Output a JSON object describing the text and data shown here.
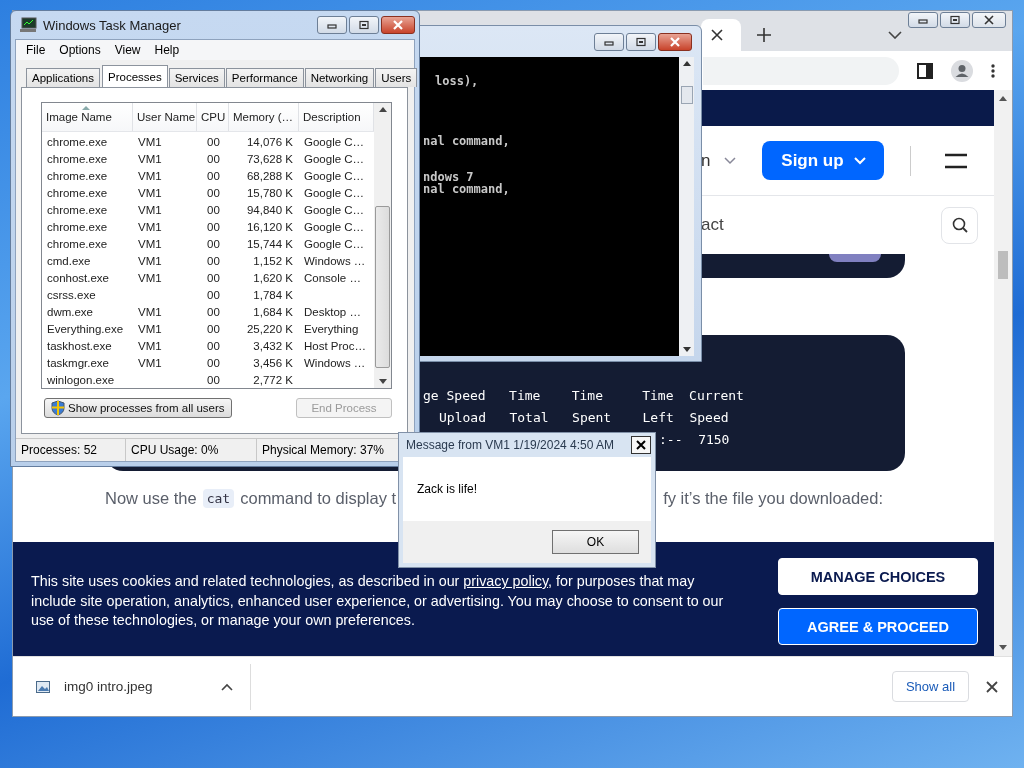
{
  "task_manager": {
    "title": "Windows Task Manager",
    "menu": [
      "File",
      "Options",
      "View",
      "Help"
    ],
    "tabs": [
      {
        "label": "Applications",
        "selected": false
      },
      {
        "label": "Processes",
        "selected": true
      },
      {
        "label": "Services",
        "selected": false
      },
      {
        "label": "Performance",
        "selected": false
      },
      {
        "label": "Networking",
        "selected": false
      },
      {
        "label": "Users",
        "selected": false
      }
    ],
    "columns": [
      {
        "label": "Image Name",
        "sorted": true
      },
      {
        "label": "User Name",
        "sorted": false
      },
      {
        "label": "CPU",
        "sorted": false
      },
      {
        "label": "Memory (…",
        "sorted": false
      },
      {
        "label": "Description",
        "sorted": false
      }
    ],
    "rows": [
      {
        "image": "chrome.exe",
        "user": "VM1",
        "cpu": "00",
        "memory": "14,076 K",
        "description": "Google C…"
      },
      {
        "image": "chrome.exe",
        "user": "VM1",
        "cpu": "00",
        "memory": "73,628 K",
        "description": "Google C…"
      },
      {
        "image": "chrome.exe",
        "user": "VM1",
        "cpu": "00",
        "memory": "68,288 K",
        "description": "Google C…"
      },
      {
        "image": "chrome.exe",
        "user": "VM1",
        "cpu": "00",
        "memory": "15,780 K",
        "description": "Google C…"
      },
      {
        "image": "chrome.exe",
        "user": "VM1",
        "cpu": "00",
        "memory": "94,840 K",
        "description": "Google C…"
      },
      {
        "image": "chrome.exe",
        "user": "VM1",
        "cpu": "00",
        "memory": "16,120 K",
        "description": "Google C…"
      },
      {
        "image": "chrome.exe",
        "user": "VM1",
        "cpu": "00",
        "memory": "15,744 K",
        "description": "Google C…"
      },
      {
        "image": "cmd.exe",
        "user": "VM1",
        "cpu": "00",
        "memory": "1,152 K",
        "description": "Windows …"
      },
      {
        "image": "conhost.exe",
        "user": "VM1",
        "cpu": "00",
        "memory": "1,620 K",
        "description": "Console …"
      },
      {
        "image": "csrss.exe",
        "cpu": "00",
        "memory": "1,784 K"
      },
      {
        "image": "dwm.exe",
        "user": "VM1",
        "cpu": "00",
        "memory": "1,684 K",
        "description": "Desktop …"
      },
      {
        "image": "Everything.exe",
        "user": "VM1",
        "cpu": "00",
        "memory": "25,220 K",
        "description": "Everything"
      },
      {
        "image": "taskhost.exe",
        "user": "VM1",
        "cpu": "00",
        "memory": "3,432 K",
        "description": "Host Proc…"
      },
      {
        "image": "taskmgr.exe",
        "user": "VM1",
        "cpu": "00",
        "memory": "3,456 K",
        "description": "Windows …"
      },
      {
        "image": "winlogon.exe",
        "cpu": "00",
        "memory": "2,772 K"
      }
    ],
    "show_all_button": {
      "label": "Show processes from all users",
      "disabled": false
    },
    "end_process_button": {
      "label": "End Process",
      "disabled": true
    },
    "status_bar": [
      "Processes: 52",
      "CPU Usage: 0%",
      "Physical Memory: 37%"
    ]
  },
  "console": {
    "lines": [
      "loss),",
      "nal command,",
      "ndows 7",
      "nal command,"
    ]
  },
  "browser": {
    "page": {
      "nav_fragment": "n",
      "signup_button": "Sign up",
      "subnav_fragment": "act",
      "terminal": {
        "header_line": "ge Speed   Time    Time     Time  Current",
        "units_line": "Upload   Total   Spent    Left  Speed",
        "tail": ":--  7150"
      },
      "paragraph": {
        "before": "Now use the",
        "code": "cat",
        "after": "command to display t",
        "end": "fy it’s the file you downloaded:"
      },
      "cookie_banner": {
        "before": "This site uses cookies and related technologies, as described in our ",
        "link": "privacy policy",
        "after": ", for purposes that may include site operation, analytics, enhanced user experience, or advertising. You may choose to consent to our use of these technologies, or manage your own preferences.",
        "manage_button": "MANAGE CHOICES",
        "agree_button": "AGREE & PROCEED"
      }
    },
    "download_bar": {
      "file": "img0 intro.jpeg",
      "show_all": "Show all"
    }
  },
  "dialog": {
    "title": "Message from VM1 1/19/2024 4:50 AM",
    "message": "Zack is life!",
    "ok_button": "OK"
  }
}
